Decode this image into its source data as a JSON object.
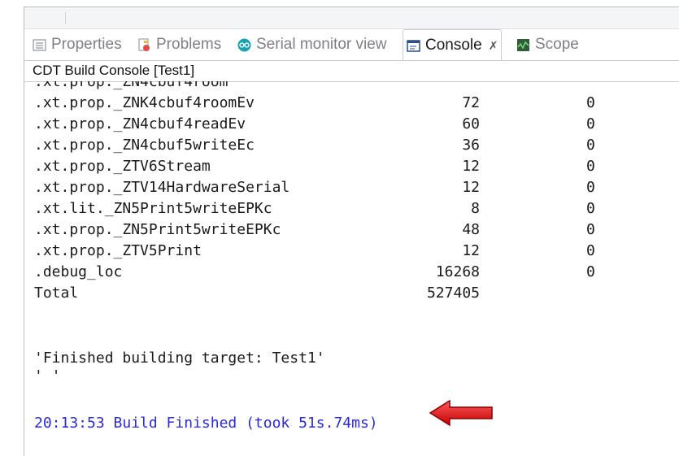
{
  "tabs": [
    {
      "label": "Properties",
      "icon": "properties-icon"
    },
    {
      "label": "Problems",
      "icon": "problems-icon"
    },
    {
      "label": "Serial monitor view",
      "icon": "serial-monitor-icon"
    },
    {
      "label": "Console",
      "icon": "console-icon",
      "active": true,
      "close": "✗"
    },
    {
      "label": "Scope",
      "icon": "scope-icon"
    }
  ],
  "console_title": "CDT Build Console [Test1]",
  "partial_top_line": ".xt.prop._ZN4cbuf4room",
  "rows": [
    {
      "name": ".xt.prop._ZNK4cbuf4roomEv",
      "size": "72",
      "addr": "0"
    },
    {
      "name": ".xt.prop._ZN4cbuf4readEv",
      "size": "60",
      "addr": "0"
    },
    {
      "name": ".xt.prop._ZN4cbuf5writeEc",
      "size": "36",
      "addr": "0"
    },
    {
      "name": ".xt.prop._ZTV6Stream",
      "size": "12",
      "addr": "0"
    },
    {
      "name": ".xt.prop._ZTV14HardwareSerial",
      "size": "12",
      "addr": "0"
    },
    {
      "name": ".xt.lit._ZN5Print5writeEPKc",
      "size": "8",
      "addr": "0"
    },
    {
      "name": ".xt.prop._ZN5Print5writeEPKc",
      "size": "48",
      "addr": "0"
    },
    {
      "name": ".xt.prop._ZTV5Print",
      "size": "12",
      "addr": "0"
    },
    {
      "name": ".debug_loc",
      "size": "16268",
      "addr": "0"
    },
    {
      "name": "Total",
      "size": "527405",
      "addr": ""
    }
  ],
  "finished_msg": "'Finished building target: Test1'",
  "quote_line": "' '",
  "build_status": "20:13:53 Build Finished (took 51s.74ms)",
  "colors": {
    "status_text": "#2a2ad6",
    "arrow": "#e01b1b"
  }
}
